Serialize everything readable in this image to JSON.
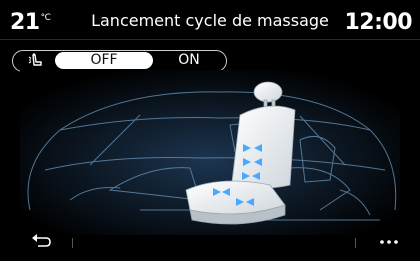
{
  "header": {
    "temperature": "21",
    "temperature_unit": "°C",
    "title": "Lancement cycle de massage",
    "clock": "12:00"
  },
  "massage_toggle": {
    "icon": "massage-seat-icon",
    "off_label": "OFF",
    "on_label": "ON",
    "selected": "OFF"
  },
  "illustration": {
    "subject": "seat-massage-zones"
  },
  "footer": {
    "back_icon": "back-arrow-icon",
    "menu_icon": "more-options-icon"
  },
  "colors": {
    "background": "#000000",
    "accent": "#4aa8ff",
    "text": "#ffffff",
    "toggle_active_bg": "#ffffff"
  }
}
